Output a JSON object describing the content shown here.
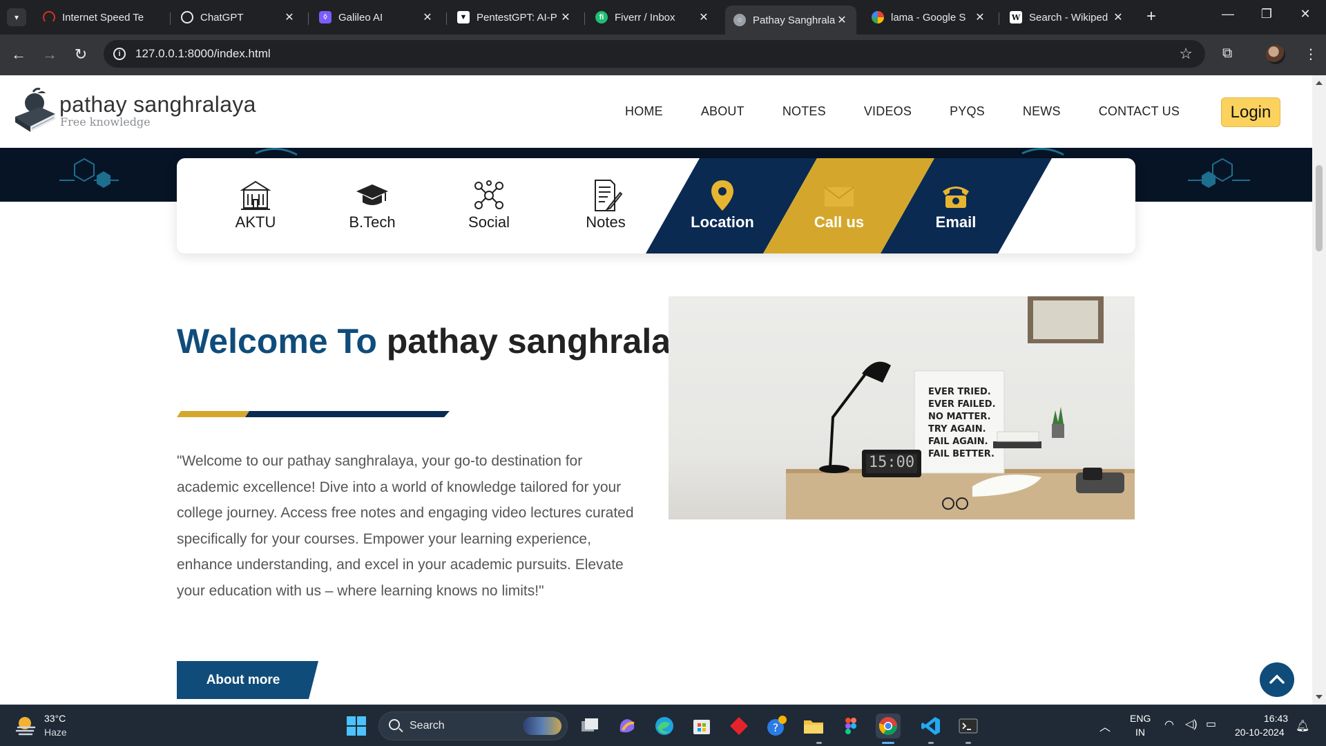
{
  "browser": {
    "tabs": [
      {
        "title": "Internet Speed Te",
        "favicon_color": "#d93025",
        "active": false
      },
      {
        "title": "ChatGPT",
        "favicon_color": "#10a37f",
        "active": false
      },
      {
        "title": "Galileo AI",
        "favicon_color": "#7c5cff",
        "active": false
      },
      {
        "title": "PentestGPT: AI-P",
        "favicon_color": "#111111",
        "active": false
      },
      {
        "title": "Fiverr / Inbox",
        "favicon_color": "#1dbf73",
        "active": false
      },
      {
        "title": "Pathay Sanghrala",
        "favicon_color": "#9aa0a6",
        "active": true
      },
      {
        "title": "lama - Google S",
        "favicon_color": "#4285f4",
        "active": false
      },
      {
        "title": "Search - Wikiped",
        "favicon_color": "#ffffff",
        "active": false
      }
    ],
    "url": "127.0.0.1:8000/index.html"
  },
  "site": {
    "brand_name": "pathay sanghralaya",
    "brand_tagline": "Free knowledge",
    "nav": [
      "HOME",
      "ABOUT",
      "NOTES",
      "VIDEOS",
      "PYQS",
      "NEWS",
      "CONTACT US"
    ],
    "login_label": "Login",
    "strip": [
      {
        "label": "AKTU",
        "icon": "university-icon"
      },
      {
        "label": "B.Tech",
        "icon": "graduation-cap-icon"
      },
      {
        "label": "Social",
        "icon": "social-network-icon"
      },
      {
        "label": "Notes",
        "icon": "notes-icon"
      },
      {
        "label": "Location",
        "icon": "location-pin-icon"
      },
      {
        "label": "Call us",
        "icon": "envelope-icon"
      },
      {
        "label": "Email",
        "icon": "telephone-icon"
      }
    ],
    "welcome_accent": "Welcome To",
    "welcome_rest": " pathay sanghralaya",
    "welcome_text": "\"Welcome to our pathay sanghralaya, your go-to destination for academic excellence! Dive into a world of knowledge tailored for your college journey. Access free notes and engaging video lectures curated specifically for your courses. Empower your learning experience, enhance understanding, and excel in your academic pursuits. Elevate your education with us – where learning knows no limits!\"",
    "about_button": "About more",
    "photo_note_lines": [
      "EVER TRIED.",
      "EVER FAILED.",
      "NO MATTER.",
      "TRY AGAIN.",
      "FAIL AGAIN.",
      "FAIL BETTER."
    ],
    "photo_clock": "15:00",
    "colors": {
      "navy": "#0a2a52",
      "gold": "#d4a72c",
      "accent_blue": "#0f4c7a",
      "login_yellow": "#fbd25d"
    }
  },
  "taskbar": {
    "weather_temp": "33°C",
    "weather_cond": "Haze",
    "search_label": "Search",
    "lang_top": "ENG",
    "lang_bottom": "IN",
    "time": "16:43",
    "date": "20-10-2024"
  }
}
